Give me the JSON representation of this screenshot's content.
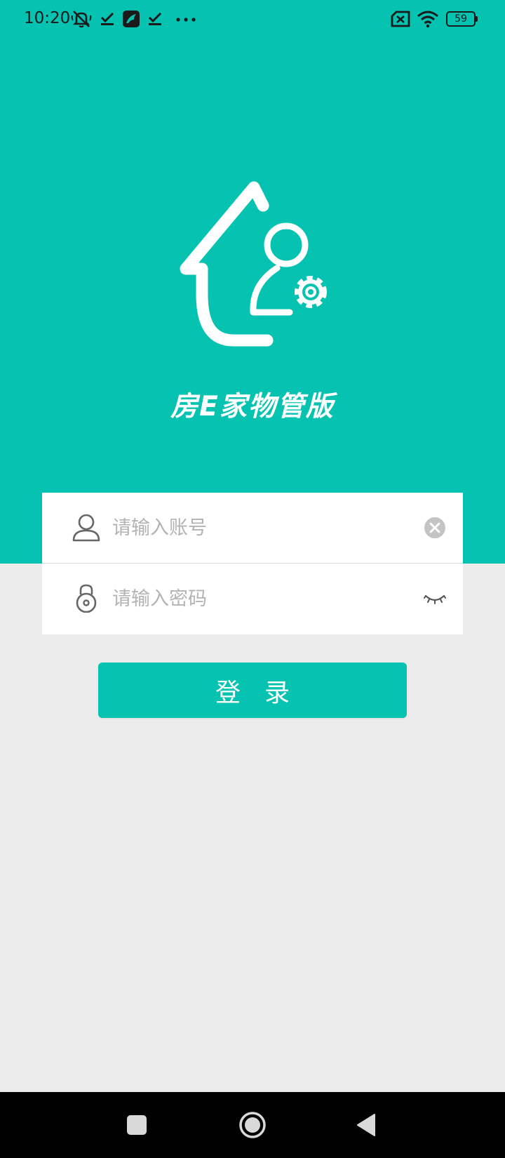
{
  "status_bar": {
    "time": "10:20",
    "battery": "59",
    "icons": [
      "mute-icon",
      "download-done-icon",
      "app-notification-icon",
      "download-done-icon",
      "more-dots-icon",
      "sim-off-icon",
      "wifi-icon",
      "battery-icon"
    ]
  },
  "app": {
    "name": "房E家物管版",
    "logo_icon": "house-person-gear-icon"
  },
  "form": {
    "account_placeholder": "请输入账号",
    "account_value": "",
    "password_placeholder": "请输入密码",
    "password_value": ""
  },
  "login": {
    "label": "登录"
  },
  "colors": {
    "primary": "#06c2b1",
    "background": "#ececec",
    "card": "#ffffff",
    "placeholder": "#b3b3b3"
  },
  "nav": {
    "icons": [
      "recent-apps-icon",
      "home-icon",
      "back-icon"
    ]
  }
}
